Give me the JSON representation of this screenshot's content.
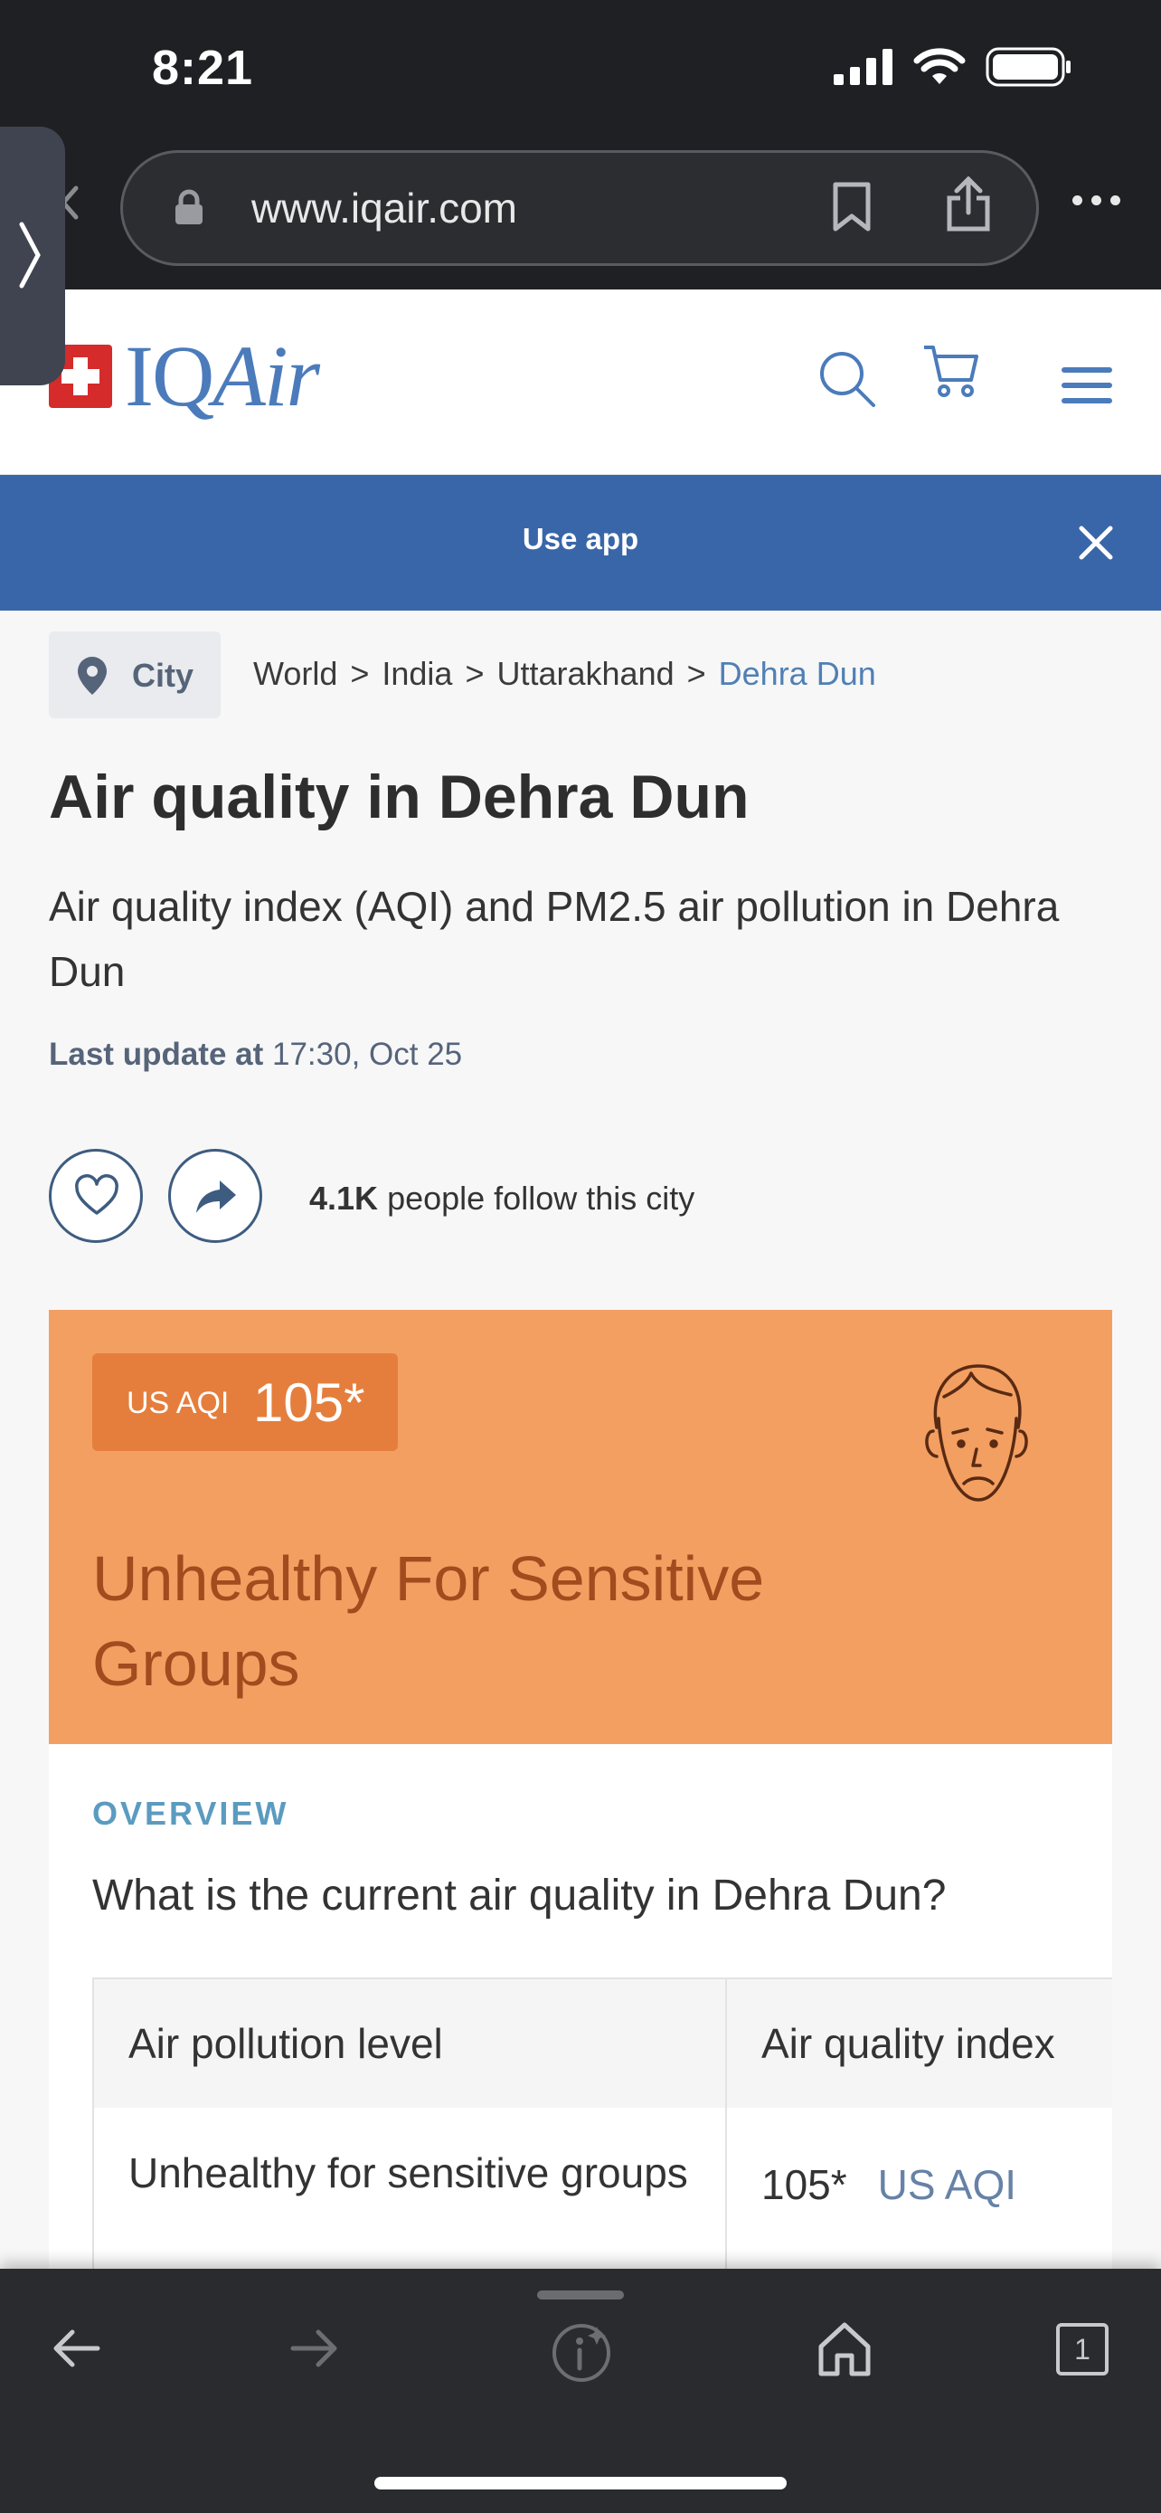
{
  "status_bar": {
    "time": "8:21"
  },
  "browser": {
    "url": "www.iqair.com",
    "icons": [
      "lock-icon",
      "bookmark-icon",
      "share-icon",
      "more-icon",
      "back-icon"
    ]
  },
  "site_header": {
    "logo_text_plain": "IQ",
    "logo_text_italic": "Air",
    "icons": [
      "search-icon",
      "cart-icon",
      "hamburger-menu-icon"
    ]
  },
  "app_banner": {
    "label": "Use app"
  },
  "breadcrumb": {
    "chip_label": "City",
    "items": [
      "World",
      "India",
      "Uttarakhand",
      "Dehra Dun"
    ],
    "separator": ">"
  },
  "page": {
    "title": "Air quality in Dehra Dun",
    "subtitle": "Air quality index (AQI) and PM2.5 air pollution in Dehra Dun",
    "last_update_label": "Last update at",
    "last_update_value": "17:30, Oct 25"
  },
  "follow": {
    "count": "4.1K",
    "text": "people follow this city"
  },
  "aqi": {
    "unit": "US AQI",
    "value": "105*",
    "status": "Unhealthy For Sensitive Groups",
    "colors": {
      "card": "#f39f62",
      "badge": "#e57e3c",
      "status_text": "#a14b1e"
    }
  },
  "overview": {
    "label": "OVERVIEW",
    "question": "What is the current air quality in Dehra Dun?",
    "table": {
      "headers": [
        "Air pollution level",
        "Air quality index"
      ],
      "rows": [
        {
          "level": "Unhealthy for sensitive groups",
          "value": "105*",
          "unit": "US AQI"
        }
      ]
    }
  },
  "toolbar": {
    "tab_count": "1",
    "icons": [
      "back-arrow-icon",
      "forward-arrow-icon",
      "info-icon",
      "home-icon",
      "tabs-icon"
    ]
  }
}
